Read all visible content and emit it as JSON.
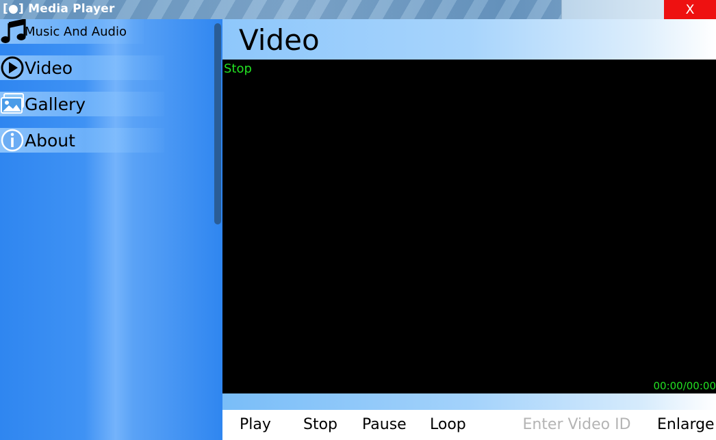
{
  "window": {
    "title": "[●] Media Player",
    "close_label": "X"
  },
  "sidebar": {
    "items": [
      {
        "label": "Music And Audio",
        "icon": "music-note-icon"
      },
      {
        "label": "Video",
        "icon": "play-circle-icon"
      },
      {
        "label": "Gallery",
        "icon": "gallery-icon"
      },
      {
        "label": "About",
        "icon": "info-icon"
      }
    ]
  },
  "main": {
    "title": "Video",
    "player": {
      "status": "Stop",
      "time": "00:00/00:00"
    },
    "controls": {
      "play_label": "Play",
      "stop_label": "Stop",
      "pause_label": "Pause",
      "loop_label": "Loop",
      "video_id_placeholder": "Enter Video ID",
      "video_id_value": "",
      "enlarge_label": "Enlarge"
    }
  },
  "colors": {
    "close_button": "#ee1111",
    "status_text": "#22e022",
    "sidebar_blue": "#2f86f0",
    "screen": "#000000",
    "scrollbar": "#2a5d96"
  }
}
